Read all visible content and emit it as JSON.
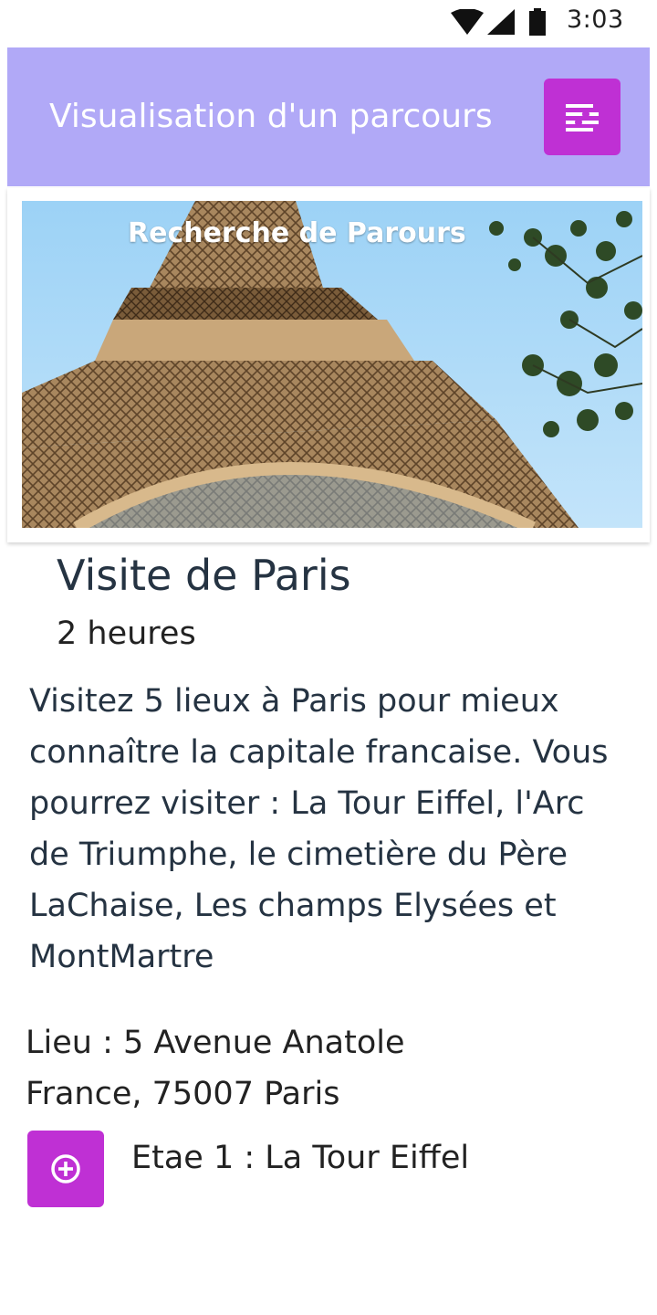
{
  "status_bar": {
    "time": "3:03",
    "icons": [
      "wifi-icon",
      "cellular-signal-icon",
      "battery-icon"
    ]
  },
  "app_bar": {
    "title": "Visualisation d'un parcours",
    "menu_icon": "filter-menu-icon",
    "background_color": "#b1a9f7",
    "button_color": "#bf30d4"
  },
  "hero": {
    "overlay_title": "Recherche de Parours",
    "image_subject": "Eiffel Tower photo"
  },
  "tour": {
    "title": "Visite de Paris",
    "duration": "2 heures",
    "description": "Visitez 5 lieux à Paris pour mieux connaître la capitale francaise. Vous pourrez visiter : La Tour Eiffel, l'Arc de Triumphe, le cimetière du Père LaChaise, Les champs Elysées et MontMartre",
    "location": "Lieu : 5 Avenue Anatole France, 75007 Paris"
  },
  "step": {
    "icon": "add-circle-icon",
    "label": "Etae 1 : La Tour Eiffel"
  }
}
